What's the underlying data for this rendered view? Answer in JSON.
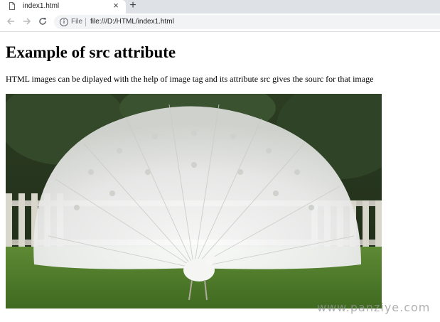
{
  "browser": {
    "tab": {
      "title": "index1.html",
      "close_glyph": "×",
      "favicon_icon": "document-icon"
    },
    "new_tab_glyph": "+",
    "toolbar": {
      "back_icon": "arrow-left-icon",
      "forward_icon": "arrow-right-icon",
      "reload_icon": "reload-icon",
      "address": {
        "info_icon": "info-icon",
        "scheme": "File",
        "url": "file:///D:/HTML/index1.html"
      }
    }
  },
  "page": {
    "heading": "Example of src attribute",
    "paragraph": "HTML images can be diplayed with the help of image tag and its attribute src gives the sourc for that image",
    "image": {
      "subject": "white-peacock-photo"
    },
    "watermark": "www.panziye.com"
  },
  "colors": {
    "tabbar_bg": "#dee1e6",
    "omnibox_bg": "#f1f3f4",
    "text": "#000000"
  }
}
